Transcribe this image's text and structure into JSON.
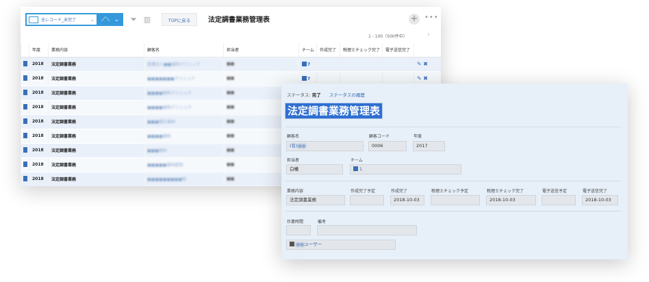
{
  "list_view": {
    "view_name": "全レコード_未完了",
    "top_button": "TOPに戻る",
    "app_title": "法定調書業務管理表",
    "pager": "1 - 100（500件中）",
    "columns": [
      "年度",
      "業務内容",
      "顧客名",
      "担当者",
      "チーム",
      "作成完了",
      "税理士チェック完了",
      "電子送信完了"
    ],
    "rows": [
      {
        "year": "2018",
        "task": "法定調書業務",
        "customer": "医療法人■■歯科クリニック",
        "staff": "■■",
        "team": "7"
      },
      {
        "year": "2018",
        "task": "法定調書業務",
        "customer": "■■■■■■■クリニック",
        "staff": "■■",
        "team": "7"
      },
      {
        "year": "2018",
        "task": "法定調書業務",
        "customer": "■■■■歯科クリニック",
        "staff": "■■",
        "team": ""
      },
      {
        "year": "2018",
        "task": "法定調書業務",
        "customer": "■■■■歯科クリニック",
        "staff": "■■",
        "team": ""
      },
      {
        "year": "2018",
        "task": "法定調書業務",
        "customer": "■■■矯正歯科",
        "staff": "■■",
        "team": ""
      },
      {
        "year": "2018",
        "task": "法定調書業務",
        "customer": "■■■■歯科",
        "staff": "■■",
        "team": ""
      },
      {
        "year": "2018",
        "task": "法定調書業務",
        "customer": "■■■歯科",
        "staff": "■■",
        "team": ""
      },
      {
        "year": "2018",
        "task": "法定調書業務",
        "customer": "■■■■■歯科医院",
        "staff": "■■",
        "team": ""
      },
      {
        "year": "2018",
        "task": "法定調書業務",
        "customer": "■■■■■■■■■院",
        "staff": "■■",
        "team": ""
      }
    ]
  },
  "detail": {
    "status_label": "ステータス:",
    "status_value": "完了",
    "status_history": "ステータスの履歴",
    "title": "法定調書業務管理表",
    "customer_label": "顧客名",
    "customer_prefix": "(有)",
    "customer_masked": "■■",
    "customer_code_label": "顧客コード",
    "customer_code": "0006",
    "year_label": "年度",
    "year": "2017",
    "staff_label": "担当者",
    "staff": "白幡",
    "team_label": "チーム",
    "team": "1",
    "task_label": "業務内容",
    "task": "法定調書業務",
    "planned_label": "作成完了予定",
    "planned": "",
    "created_label": "作成完了",
    "created": "2018-10-03",
    "check_plan_label": "税理士チェック予定",
    "check_plan": "",
    "check_done_label": "税理士チェック完了",
    "check_done": "2018-10-03",
    "send_plan_label": "電子送信予定",
    "send_plan": "",
    "send_done_label": "電子送信完了",
    "send_done": "2018-10-03",
    "hours_label": "作業時間",
    "notes_label": "備考",
    "user_masked": "■■",
    "user_suffix": "ユーザー"
  },
  "colors": {
    "accent": "#3498db",
    "title_bg": "#2f6fd0",
    "link": "#3a6ab0",
    "row_odd": "#e9f0fa"
  }
}
